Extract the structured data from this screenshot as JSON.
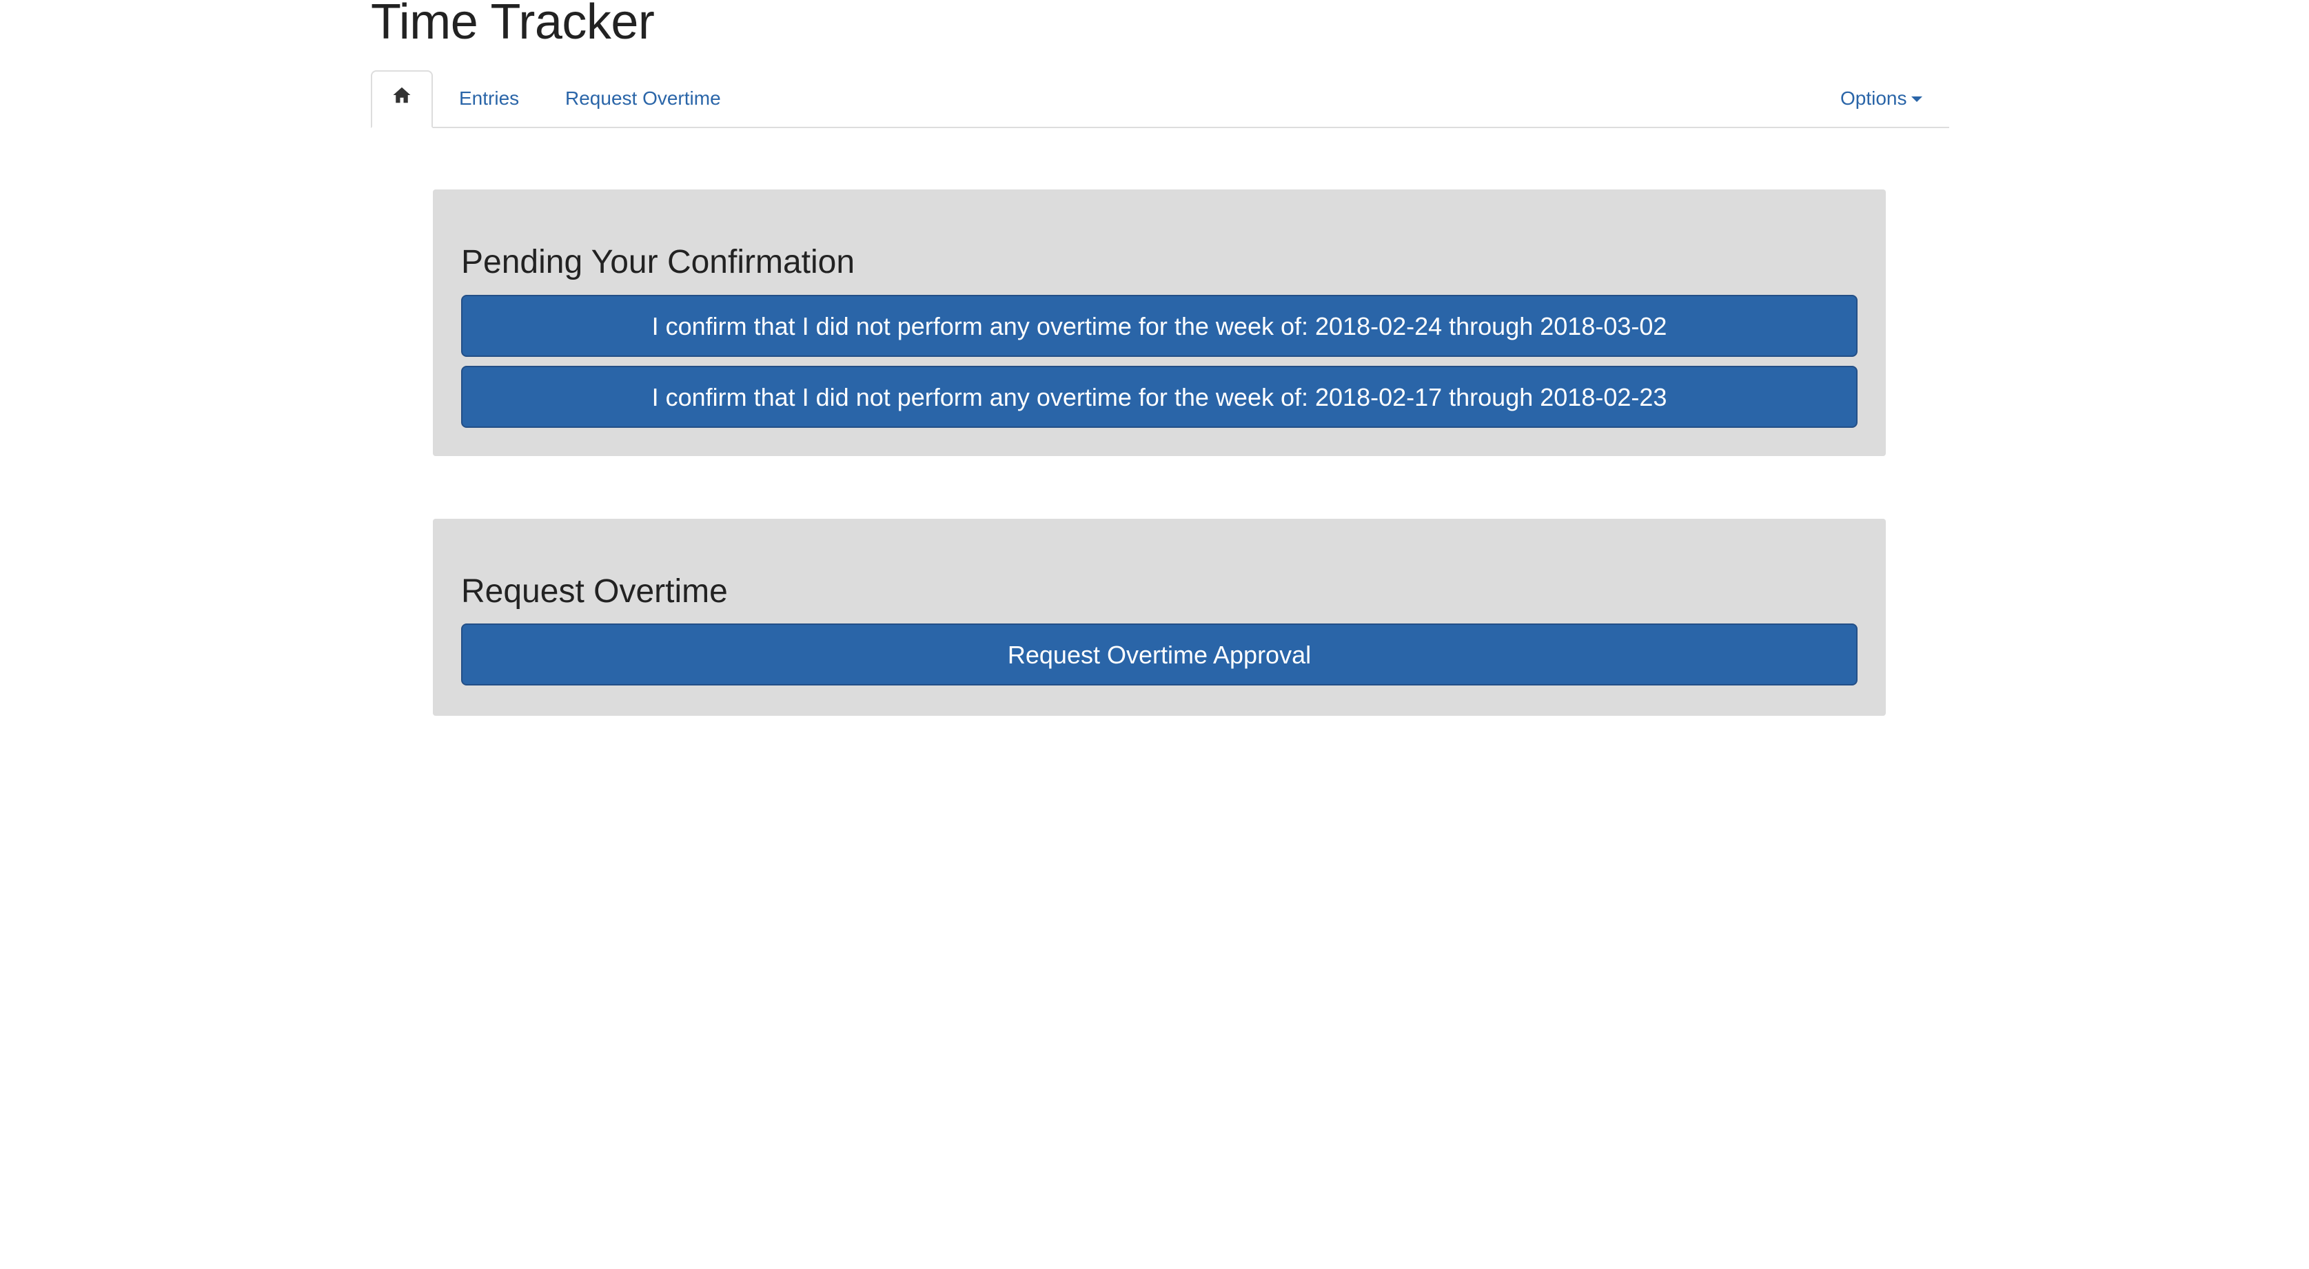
{
  "app": {
    "title": "Time Tracker"
  },
  "nav": {
    "home_icon": "home-icon",
    "tabs": [
      {
        "label": "Entries"
      },
      {
        "label": "Request Overtime"
      }
    ],
    "options_label": "Options"
  },
  "pending": {
    "heading": "Pending Your Confirmation",
    "buttons": [
      {
        "label": "I confirm that I did not perform any overtime for the week of: 2018-02-24 through 2018-03-02"
      },
      {
        "label": "I confirm that I did not perform any overtime for the week of: 2018-02-17 through 2018-02-23"
      }
    ]
  },
  "request": {
    "heading": "Request Overtime",
    "button_label": "Request Overtime Approval"
  },
  "colors": {
    "accent": "#2a65a8",
    "panel_bg": "#dcdcdc",
    "text": "#222222"
  }
}
